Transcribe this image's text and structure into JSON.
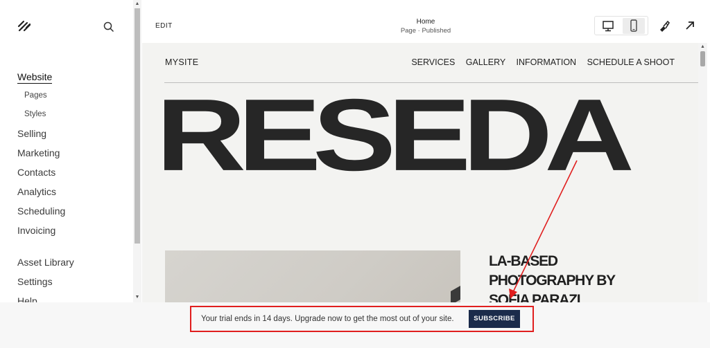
{
  "sidebar": {
    "logo_icon": "squarespace-logo-icon",
    "search_icon": "search-icon",
    "items": [
      {
        "label": "Website"
      },
      {
        "label": "Pages"
      },
      {
        "label": "Styles"
      },
      {
        "label": "Selling"
      },
      {
        "label": "Marketing"
      },
      {
        "label": "Contacts"
      },
      {
        "label": "Analytics"
      },
      {
        "label": "Scheduling"
      },
      {
        "label": "Invoicing"
      },
      {
        "label": "Asset Library"
      },
      {
        "label": "Settings"
      },
      {
        "label": "Help"
      }
    ]
  },
  "topbar": {
    "edit_label": "EDIT",
    "page_title": "Home",
    "page_status": "Page · Published",
    "desktop_icon": "desktop-icon",
    "mobile_icon": "mobile-icon",
    "design_icon": "paintbrush-icon",
    "open_icon": "arrow-up-right-icon"
  },
  "site": {
    "name": "MYSITE",
    "nav": [
      "SERVICES",
      "GALLERY",
      "INFORMATION",
      "SCHEDULE A SHOOT"
    ],
    "hero": "RESEDA",
    "tagline_lines": [
      "LA-BASED",
      "PHOTOGRAPHY BY",
      "SOFIA PARAZI"
    ]
  },
  "trial_bar": {
    "message": "Your trial ends in 14 days. Upgrade now to get the most out of your site.",
    "button_label": "SUBSCRIBE"
  },
  "colors": {
    "subscribe_bg": "#1b2b4b",
    "annotation_red": "#e01e1e",
    "canvas_bg": "#f3f3f1"
  }
}
